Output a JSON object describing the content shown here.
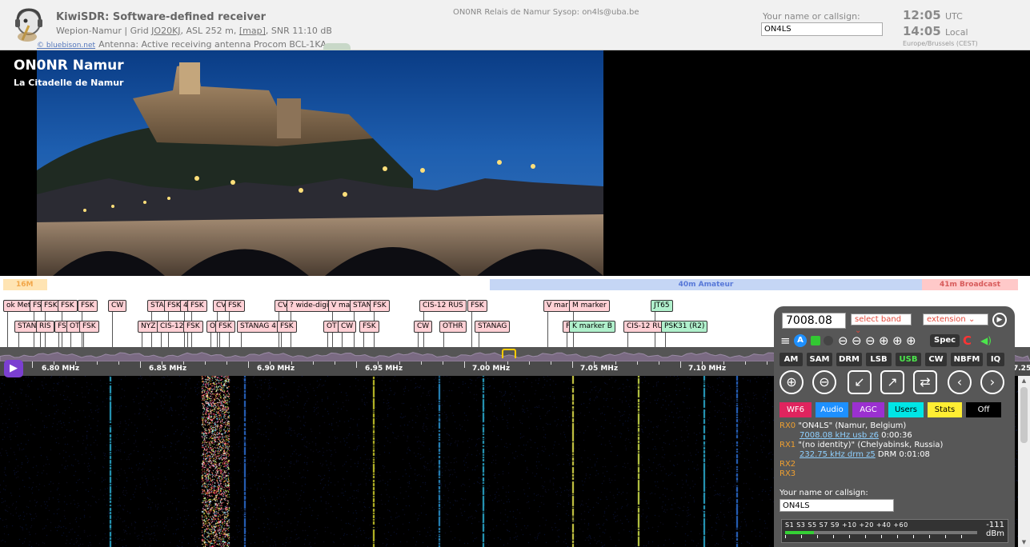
{
  "header": {
    "title": "KiwiSDR: Software-defined receiver",
    "site_info_prefix": "Wepion-Namur | Grid ",
    "grid": "JO20KJ",
    "site_info_mid": ", ASL 252 m, ",
    "map_link": "[map]",
    "site_info_suffix": ", SNR 11:10 dB",
    "copyright": "© bluebison.net",
    "antenna": "Antenna: Active receiving antenna Procom BCL-1KA",
    "relay": "ON0NR Relais de Namur Sysop: on4ls@uba.be",
    "callsign_label": "Your name or callsign:",
    "callsign_value": "ON4LS",
    "utc_time": "12:05",
    "utc_label": "UTC",
    "local_time": "14:05",
    "local_label": "Local",
    "timezone": "Europe/Brussels (CEST)"
  },
  "banner": {
    "station_name": "ON0NR Namur",
    "subtitle": "La Citadelle de Namur"
  },
  "bands": [
    {
      "id": "16m",
      "label": "16M"
    },
    {
      "id": "40m",
      "label": "40m Amateur"
    },
    {
      "id": "41m",
      "label": "41m Broadcast"
    }
  ],
  "labels_row1": [
    "ok Met",
    "FS",
    "FSK",
    "FSK",
    "FSK",
    "CW",
    "STA",
    "FSK",
    "4",
    "FSK",
    "CV",
    "FSK",
    "CV",
    "? wide-digit",
    "V ma",
    "STAN",
    "FSK",
    "CIS-12 RUS",
    "FSK",
    "V mar",
    "M marker",
    "JT65"
  ],
  "labels_row2": [
    "STAN",
    "RIS",
    "FSK",
    "OT",
    "FSK",
    "NYZ",
    "CIS-12",
    "FSK",
    "O",
    "FSK",
    "STANAG 4",
    "FSK",
    "OT",
    "CW",
    "FSK",
    "CW",
    "OTHR",
    "STANAG",
    "F",
    "K marker B",
    "CIS-12 RU",
    "PSK31 (R2)"
  ],
  "scale": {
    "ticks": [
      "6.80 MHz",
      "6.85 MHz",
      "6.90 MHz",
      "6.95 MHz",
      "7.00 MHz",
      "7.05 MHz",
      "7.10 MHz",
      "7.25"
    ]
  },
  "panel": {
    "frequency": "7008.08",
    "band_select": "select band",
    "extension_select": "extension",
    "icons": {
      "menu": "≡",
      "a": "A",
      "zoom_out_a": "⊖",
      "zoom_out_b": "⊖",
      "zoom_out_c": "⊖",
      "zoom_in_a": "⊕",
      "zoom_in_b": "⊕",
      "zoom_in_c": "⊕",
      "spec": "Spec",
      "reload": "C",
      "speaker": "◀)"
    },
    "modes": [
      {
        "label": "AM",
        "active": false
      },
      {
        "label": "SAM",
        "active": false
      },
      {
        "label": "DRM",
        "active": false
      },
      {
        "label": "LSB",
        "active": false
      },
      {
        "label": "USB",
        "active": true
      },
      {
        "label": "CW",
        "active": false
      },
      {
        "label": "NBFM",
        "active": false
      },
      {
        "label": "IQ",
        "active": false
      }
    ],
    "nav": {
      "zoom_in": "⊕",
      "zoom_out": "⊖",
      "zoom_max_in": "↙",
      "zoom_max_out": "↗",
      "swap": "⇄",
      "prev": "‹",
      "next": "›"
    },
    "tabs": [
      {
        "label": "WF6",
        "bg": "#e0245e",
        "fg": "#ffffff"
      },
      {
        "label": "Audio",
        "bg": "#1e90ff",
        "fg": "#ffffff"
      },
      {
        "label": "AGC",
        "bg": "#9b30d0",
        "fg": "#ffffff"
      },
      {
        "label": "Users",
        "bg": "#00e5e5",
        "fg": "#000000"
      },
      {
        "label": "Stats",
        "bg": "#ffee33",
        "fg": "#000000"
      },
      {
        "label": "Off",
        "bg": "#000000",
        "fg": "#ffffff"
      }
    ],
    "users": [
      {
        "rx": "RX0",
        "who": "\"ON4LS\" (Namur, Belgium)",
        "link": "7008.08 kHz usb z6",
        "time": "0:00:36"
      },
      {
        "rx": "RX1",
        "who": "\"(no identity)\" (Chelyabinsk, Russia)",
        "link": "232.75 kHz drm z5",
        "time": "DRM 0:01:08"
      },
      {
        "rx": "RX2",
        "who": "",
        "link": "",
        "time": ""
      },
      {
        "rx": "RX3",
        "who": "",
        "link": "",
        "time": ""
      }
    ],
    "callsign_label": "Your name or callsign:",
    "callsign_value": "ON4LS",
    "smeter_scale": "S1  S3  S5  S7  S9 +10 +20     +40   +60",
    "smeter_value": "-111",
    "smeter_unit": "dBm",
    "smeter_level": 0.15
  },
  "colors": {
    "panel_bg": "#575757",
    "accent_purple": "#7b3fd1",
    "usb_active": "#4ce64c"
  }
}
